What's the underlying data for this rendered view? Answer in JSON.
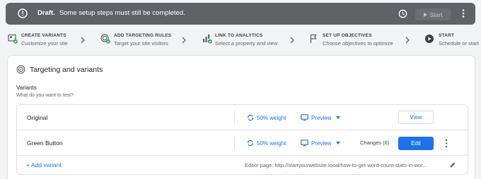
{
  "draft_bar": {
    "status_bold": "Draft.",
    "status_text": "Some setup steps must still be completed.",
    "start_label": "Start"
  },
  "steps": [
    {
      "title": "CREATE VARIANTS",
      "subtitle": "Customize your site",
      "icon": "variants-check-icon"
    },
    {
      "title": "ADD TARGETING RULES",
      "subtitle": "Target your site visitors",
      "icon": "target-check-icon"
    },
    {
      "title": "LINK TO ANALYTICS",
      "subtitle": "Select a property and view",
      "icon": "analytics-check-icon"
    },
    {
      "title": "SET UP OBJECTIVES",
      "subtitle": "Choose objectives to optimize",
      "icon": "flag-icon"
    },
    {
      "title": "START",
      "subtitle": "Schedule or start",
      "icon": "play-circle-icon"
    }
  ],
  "card": {
    "title": "Targeting and variants",
    "variants_label": "Variants",
    "variants_question": "What do you want to test?"
  },
  "variants": [
    {
      "name": "Original",
      "weight": "50% weight",
      "preview": "Preview",
      "action": "View"
    },
    {
      "name": "Green Button",
      "weight": "50% weight",
      "preview": "Preview",
      "changes": "Changes (6)",
      "action": "Edit"
    }
  ],
  "footer": {
    "add_variant": "+ Add variant",
    "editor_page": "Editor page: http://startyourwebsite.local/how-to-get-word-count-stats-in-wor..."
  },
  "colors": {
    "accent": "#1a73e8",
    "draft_bar": "#5f6368",
    "success": "#34a853"
  }
}
